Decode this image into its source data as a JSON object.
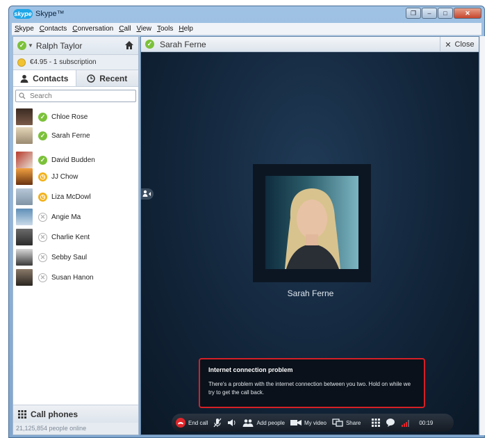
{
  "window": {
    "logo": "skype",
    "title": "Skype™",
    "controls": [
      "restore",
      "minimize",
      "maximize",
      "close"
    ]
  },
  "menu": [
    "Skype",
    "Contacts",
    "Conversation",
    "Call",
    "View",
    "Tools",
    "Help"
  ],
  "user": {
    "name": "Ralph Taylor",
    "status": "online"
  },
  "credit": {
    "text": "€4.95 - 1 subscription"
  },
  "tabs": {
    "contacts": "Contacts",
    "recent": "Recent"
  },
  "search": {
    "placeholder": "Search"
  },
  "contacts": [
    {
      "name": "Chloe Rose",
      "status": "online"
    },
    {
      "name": "Sarah Ferne",
      "status": "online"
    },
    {
      "name": "David Budden",
      "status": "online"
    },
    {
      "name": "JJ Chow",
      "status": "away"
    },
    {
      "name": "Liza McDowl",
      "status": "away"
    },
    {
      "name": "Angie Ma",
      "status": "offline"
    },
    {
      "name": "Charlie Kent",
      "status": "offline"
    },
    {
      "name": "Sebby Saul",
      "status": "offline"
    },
    {
      "name": "Susan Hanon",
      "status": "offline"
    }
  ],
  "call_phones": "Call phones",
  "people_online": "21,125,854 people online",
  "conversation": {
    "name": "Sarah Ferne",
    "close_label": "Close"
  },
  "caller_name": "Sarah Ferne",
  "alert": {
    "title": "Internet connection problem",
    "message": "There's a problem with the internet connection between you two. Hold on while we try to get the call back."
  },
  "toolbar": {
    "end_call": "End call",
    "add_people": "Add people",
    "my_video": "My video",
    "share": "Share",
    "timer": "00:19"
  },
  "colors": {
    "online": "#7cc13a",
    "away": "#f3b21c",
    "end_call": "#e0262b",
    "alert_border": "#d61f26"
  }
}
